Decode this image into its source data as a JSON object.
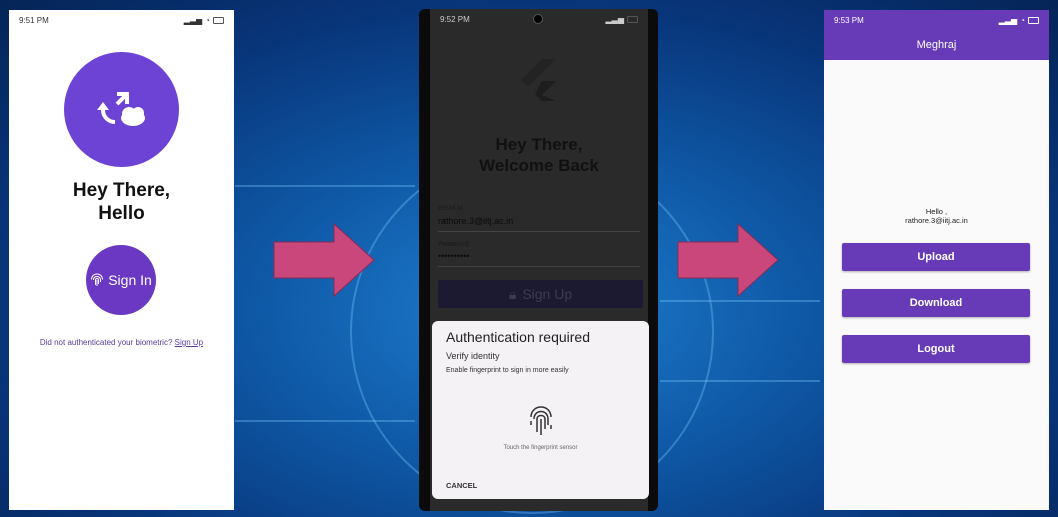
{
  "screen1": {
    "status_time": "9:51 PM",
    "title_line1": "Hey There,",
    "title_line2": "Hello",
    "signin_label": "Sign In",
    "footer_text": "Did not authenticated your biometric?",
    "footer_link": "Sign Up"
  },
  "screen2": {
    "status_time": "9:52 PM",
    "title_line1": "Hey There,",
    "title_line2": "Welcome Back",
    "email_label": "Email id",
    "email_value": "rathore.3@iitj.ac.in",
    "password_label": "Password",
    "password_value": "••••••••••",
    "signup_button": "Sign Up",
    "dialog": {
      "title": "Authentication required",
      "subtitle": "Verify identity",
      "description": "Enable fingerprint to sign in more easily",
      "hint": "Touch the fingerprint sensor",
      "cancel": "CANCEL"
    }
  },
  "screen3": {
    "status_time": "9:53 PM",
    "appbar_title": "Meghraj",
    "hello_line1": "Hello ,",
    "hello_line2": "rathore.3@iitj.ac.in",
    "upload_button": "Upload",
    "download_button": "Download",
    "logout_button": "Logout"
  },
  "colors": {
    "primary": "#673ab7",
    "arrow": "#c9477a",
    "background": "#0f5aa8"
  }
}
